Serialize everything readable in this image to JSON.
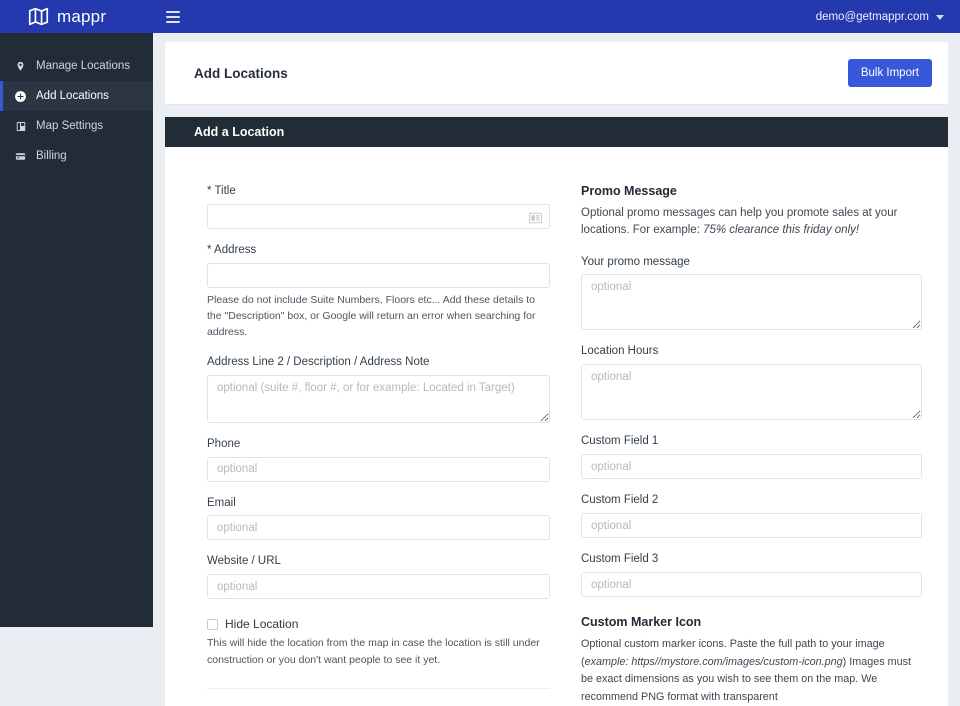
{
  "topbar": {
    "brand_name": "mappr",
    "logo_icon": "folded-map-icon",
    "menu_icon": "hamburger-icon",
    "account_email": "demo@getmappr.com",
    "account_caret_icon": "chevron-down-icon",
    "bg_color": "#2439ad"
  },
  "sidebar": {
    "bg_color": "#222c36",
    "active_accent_color": "#3758d8",
    "items": [
      {
        "label": "Manage Locations",
        "icon": "map-pin-icon",
        "active": false
      },
      {
        "label": "Add Locations",
        "icon": "plus-circle-icon",
        "active": true
      },
      {
        "label": "Map Settings",
        "icon": "map-book-icon",
        "active": false
      },
      {
        "label": "Billing",
        "icon": "credit-card-icon",
        "active": false
      }
    ]
  },
  "page": {
    "title": "Add Locations",
    "bulk_import_label": "Bulk Import",
    "bulk_import_color": "#3758d8",
    "panel_title": "Add a Location"
  },
  "form_left": {
    "title": {
      "label": "* Title",
      "value": "",
      "placeholder": "",
      "icon": "contact-card-icon"
    },
    "address": {
      "label": "* Address",
      "value": "",
      "placeholder": "",
      "help": "Please do not include Suite Numbers, Floors etc... Add these details to the \"Description\" box, or Google will return an error when searching for address."
    },
    "address_line2": {
      "label": "Address Line 2 / Description / Address Note",
      "value": "",
      "placeholder": "optional (suite #, floor #, or for example: Located in Target)"
    },
    "phone": {
      "label": "Phone",
      "value": "",
      "placeholder": "optional"
    },
    "email": {
      "label": "Email",
      "value": "",
      "placeholder": "optional"
    },
    "website": {
      "label": "Website / URL",
      "value": "",
      "placeholder": "optional"
    },
    "hide_location": {
      "label": "Hide Location",
      "checked": false,
      "help": "This will hide the location from the map in case the location is still under construction or you don't want people to see it yet."
    }
  },
  "form_right": {
    "promo_section": {
      "title": "Promo Message",
      "desc_prefix": "Optional promo messages can help you promote sales at your locations. For example: ",
      "desc_example": "75% clearance this friday only!"
    },
    "promo_message": {
      "label": "Your promo message",
      "value": "",
      "placeholder": "optional"
    },
    "location_hours": {
      "label": "Location Hours",
      "value": "",
      "placeholder": "optional"
    },
    "custom_field_1": {
      "label": "Custom Field 1",
      "value": "",
      "placeholder": "optional"
    },
    "custom_field_2": {
      "label": "Custom Field 2",
      "value": "",
      "placeholder": "optional"
    },
    "custom_field_3": {
      "label": "Custom Field 3",
      "value": "",
      "placeholder": "optional"
    },
    "marker_section": {
      "title": "Custom Marker Icon",
      "desc_part1": "Optional custom marker icons. Paste the full path to your image (",
      "desc_example_label": "example:",
      "desc_example_url": "https//mystore.com/images/custom-icon.png",
      "desc_part2": ") Images must be exact dimensions as you wish to see them on the map. We recommend PNG format with transparent"
    }
  }
}
